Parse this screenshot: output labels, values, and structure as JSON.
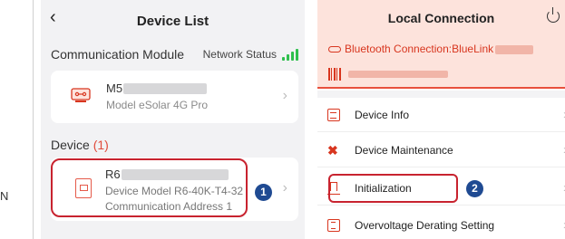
{
  "left_edge": {
    "stub_text": "N"
  },
  "device_list": {
    "title": "Device List",
    "back_icon": "chevron-left-icon",
    "communication_module": {
      "section_label": "Communication Module",
      "network_status_label": "Network Status",
      "module_name": "M5",
      "module_model": "Model  eSolar 4G Pro"
    },
    "device_section": {
      "label": "Device",
      "count": "(1)",
      "device_name": "R6",
      "device_model": "Device Model  R6-40K-T4-32",
      "communication_address": "Communication Address  1"
    },
    "callout": "1"
  },
  "local_connection": {
    "title": "Local Connection",
    "power_icon": "power-icon",
    "bluetooth_text": "Bluetooth Connection:BlueLink",
    "menu_items": [
      {
        "label": "Device Info",
        "icon": "document-icon"
      },
      {
        "label": "Device Maintenance",
        "icon": "tools-icon"
      },
      {
        "label": "Initialization",
        "icon": "init-icon"
      },
      {
        "label": "Overvoltage Derating Setting",
        "icon": "voltage-icon"
      }
    ],
    "callout": "2"
  },
  "colors": {
    "accent": "#d8361f",
    "highlight": "#c8232f",
    "callout": "#1f4a92",
    "signal": "#2fbf4d"
  }
}
